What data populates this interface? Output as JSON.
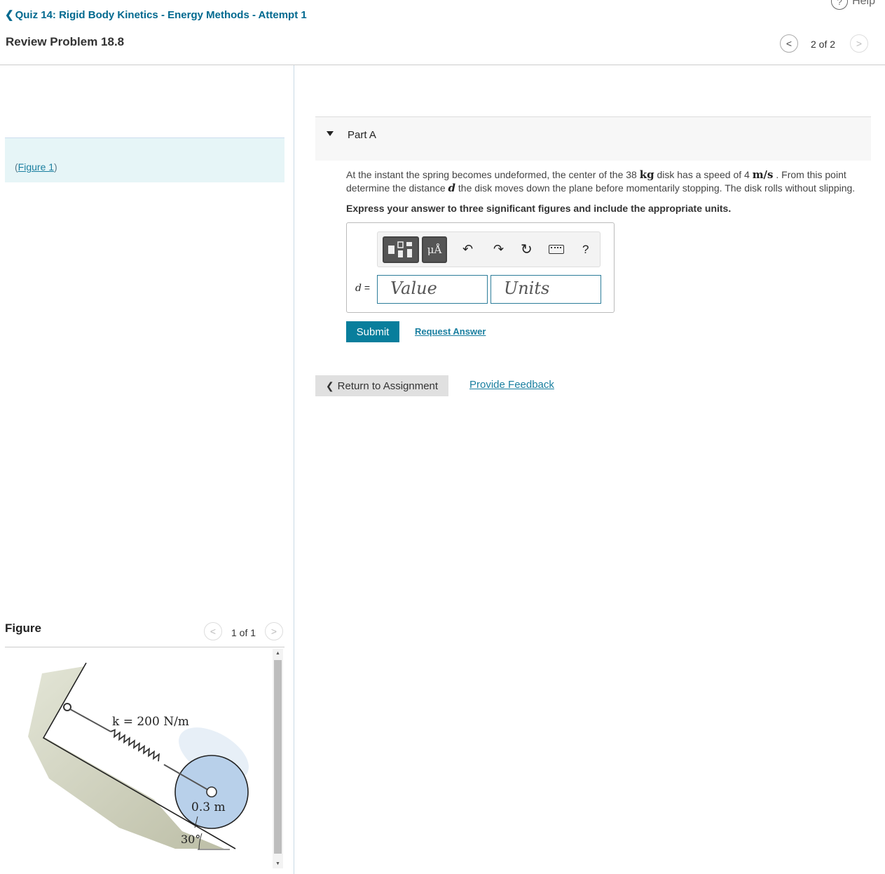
{
  "header": {
    "back_label": "Quiz 14: Rigid Body Kinetics - Energy Methods - Attempt 1",
    "help_label": "Help",
    "problem_title": "Review Problem 18.8",
    "pager": "2 of 2"
  },
  "left": {
    "figure_link_open": "(",
    "figure_link_text": "Figure 1",
    "figure_link_close": ")",
    "figure_heading": "Figure",
    "figure_pager": "1 of 1",
    "figure_labels": {
      "spring": "k = 200 N/m",
      "radius": "0.3 m",
      "angle": "30°"
    }
  },
  "part": {
    "label": "Part A",
    "question_1": "At the instant the spring becomes undeformed, the center of the 38 ",
    "unit_kg": "kg",
    "question_2": " disk has a speed of 4 ",
    "unit_speed": "m/s",
    "question_3": " . From this point determine the distance ",
    "var_d": "d",
    "question_4": " the disk moves down the plane before momentarily stopping. The disk rolls without slipping.",
    "instruction": "Express your answer to three significant figures and include the appropriate units."
  },
  "answer": {
    "units_button": "μÅ",
    "help_button": "?",
    "variable": "d",
    "equals": "=",
    "value_placeholder": "Value",
    "units_placeholder": "Units"
  },
  "actions": {
    "submit": "Submit",
    "request_answer": "Request Answer",
    "return": "Return to Assignment",
    "feedback": "Provide Feedback"
  }
}
